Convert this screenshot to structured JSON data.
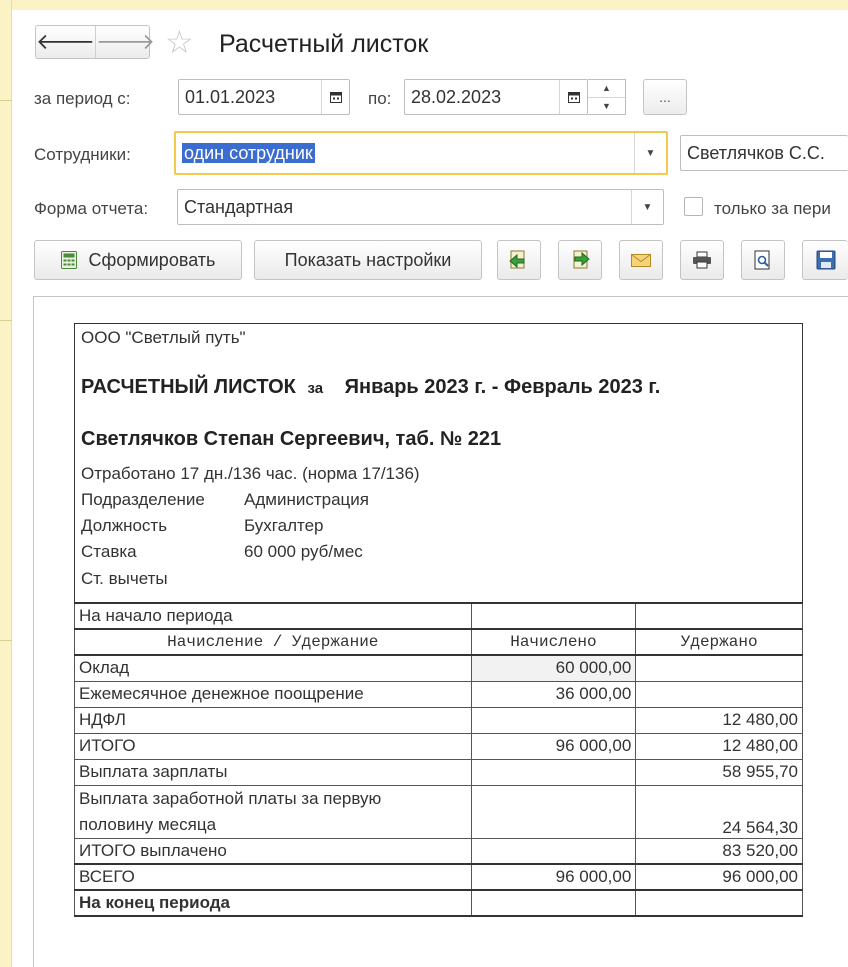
{
  "window": {
    "title": "Расчетный листок"
  },
  "filters": {
    "period_from_label": "за период с:",
    "period_from": "01.01.2023",
    "period_to_label": "по:",
    "period_to": "28.02.2023",
    "more_label": "...",
    "employees_label": "Сотрудники:",
    "employees_mode": "один сотрудник",
    "employee": "Светлячков С.С.",
    "form_label": "Форма отчета:",
    "form_value": "Стандартная",
    "only_period_label": "только за пери"
  },
  "toolbar": {
    "generate_label": "Сформировать",
    "settings_label": "Показать настройки"
  },
  "report": {
    "org": "ООО \"Светлый путь\"",
    "heading": "РАСЧЕТНЫЙ ЛИСТОК",
    "heading_za": "за",
    "heading_period": "Январь 2023 г. - Февраль 2023 г.",
    "employee": "Светлячков Степан Сергеевич, таб. № 221",
    "worked": "Отработано 17 дн./136 час. (норма 17/136)",
    "info": [
      {
        "label": "Подразделение",
        "value": "Администрация"
      },
      {
        "label": "Должность",
        "value": "Бухгалтер"
      },
      {
        "label": "Ставка",
        "value": "60 000 руб/мес"
      },
      {
        "label": "Ст. вычеты",
        "value": ""
      }
    ],
    "period_start": "На начало периода",
    "columns": [
      "Начисление / Удержание",
      "Начислено",
      "Удержано"
    ],
    "rows": [
      {
        "name": "Оклад",
        "accrued": "60 000,00",
        "withheld": ""
      },
      {
        "name": "Ежемесячное денежное поощрение",
        "accrued": "36 000,00",
        "withheld": ""
      },
      {
        "name": "НДФЛ",
        "accrued": "",
        "withheld": "12 480,00"
      },
      {
        "name": "ИТОГО",
        "accrued": "96 000,00",
        "withheld": "12 480,00"
      },
      {
        "name": "Выплата зарплаты",
        "accrued": "",
        "withheld": "58 955,70"
      },
      {
        "name": "Выплата заработной платы за первую",
        "accrued": "",
        "withheld": ""
      },
      {
        "name": "половину месяца",
        "accrued": "",
        "withheld": "24 564,30"
      },
      {
        "name": "ИТОГО выплачено",
        "accrued": "",
        "withheld": "83 520,00"
      },
      {
        "name": "ВСЕГО",
        "accrued": "96 000,00",
        "withheld": "96 000,00"
      }
    ],
    "period_end": "На конец периода"
  },
  "colors": {
    "accent_yellow": "#f2c94c",
    "selection": "#3b6ccf",
    "frame_bg": "#fbf2c6"
  }
}
